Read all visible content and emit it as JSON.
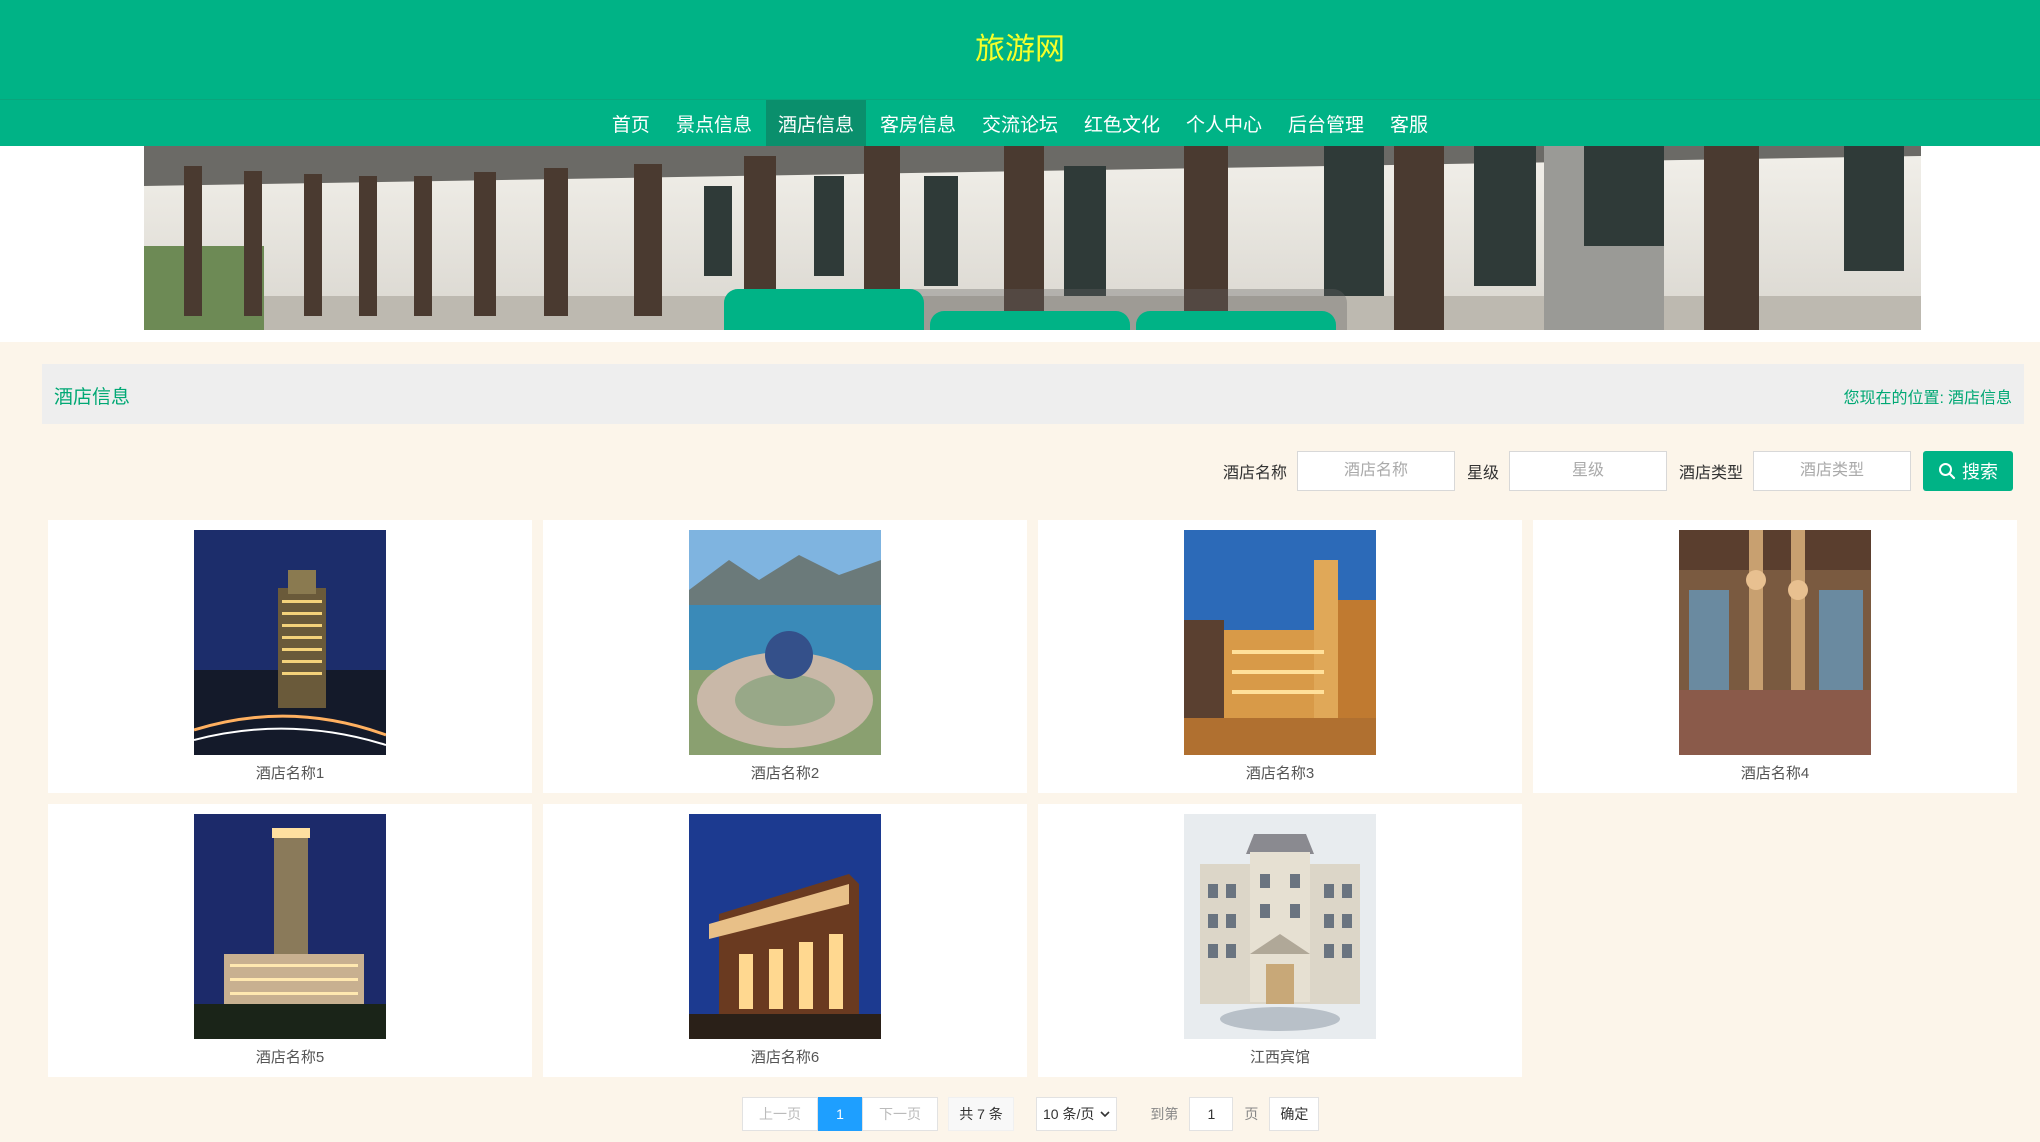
{
  "site": {
    "title": "旅游网"
  },
  "nav": {
    "items": [
      {
        "label": "首页",
        "active": false
      },
      {
        "label": "景点信息",
        "active": false
      },
      {
        "label": "酒店信息",
        "active": true
      },
      {
        "label": "客房信息",
        "active": false
      },
      {
        "label": "交流论坛",
        "active": false
      },
      {
        "label": "红色文化",
        "active": false
      },
      {
        "label": "个人中心",
        "active": false
      },
      {
        "label": "后台管理",
        "active": false
      },
      {
        "label": "客服",
        "active": false
      }
    ]
  },
  "banner": {
    "slides": 3,
    "active_slide": 1
  },
  "breadcrumb": {
    "title": "酒店信息",
    "prefix": "您现在的位置:",
    "current": "酒店信息"
  },
  "search": {
    "name_label": "酒店名称",
    "name_placeholder": "酒店名称",
    "star_label": "星级",
    "star_placeholder": "星级",
    "type_label": "酒店类型",
    "type_placeholder": "酒店类型",
    "button_label": "搜索"
  },
  "hotels": [
    {
      "name": "酒店名称1"
    },
    {
      "name": "酒店名称2"
    },
    {
      "name": "酒店名称3"
    },
    {
      "name": "酒店名称4"
    },
    {
      "name": "酒店名称5"
    },
    {
      "name": "酒店名称6"
    },
    {
      "name": "江西宾馆"
    }
  ],
  "pagination": {
    "prev": "上一页",
    "current_page": "1",
    "next": "下一页",
    "total": "共 7 条",
    "page_size": "10 条/页",
    "goto_prefix": "到第",
    "goto_value": "1",
    "goto_suffix": "页",
    "confirm": "确定"
  },
  "colors": {
    "primary": "#00b386",
    "title": "#f6ff2a",
    "page_bg": "#fcf5ea",
    "pager_active": "#1e9fff"
  }
}
